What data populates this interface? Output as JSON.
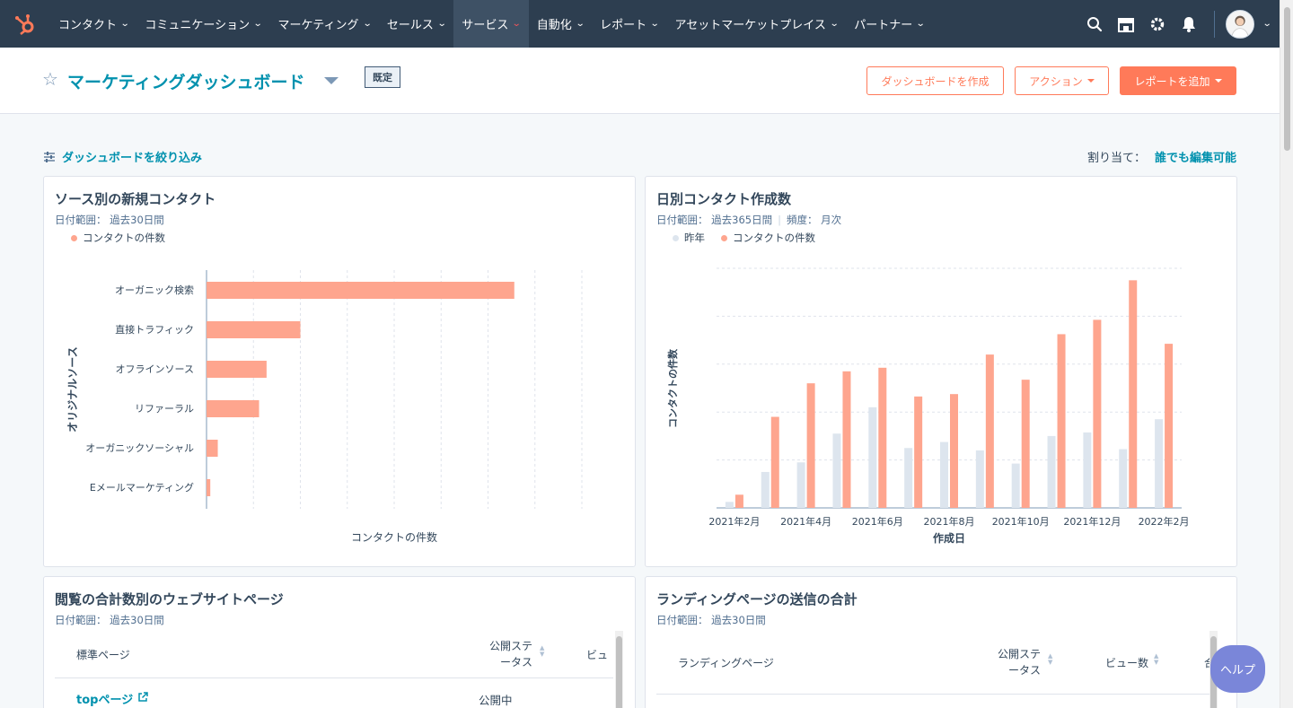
{
  "nav": {
    "items": [
      {
        "label": "コンタクト",
        "active": false
      },
      {
        "label": "コミュニケーション",
        "active": false
      },
      {
        "label": "マーケティング",
        "active": false
      },
      {
        "label": "セールス",
        "active": false
      },
      {
        "label": "サービス",
        "active": true
      },
      {
        "label": "自動化",
        "active": false
      },
      {
        "label": "レポート",
        "active": false
      },
      {
        "label": "アセットマーケットプレイス",
        "active": false
      },
      {
        "label": "パートナー",
        "active": false
      }
    ],
    "chevron": "⌄",
    "icons": [
      "search-icon",
      "marketplace-icon",
      "gear-icon",
      "bell-icon"
    ]
  },
  "header": {
    "title": "マーケティングダッシュボード",
    "badge": "既定",
    "create_button": "ダッシュボードを作成",
    "actions_button": "アクション",
    "add_report_button": "レポートを追加"
  },
  "filters": {
    "filter_label": "ダッシュボードを絞り込み",
    "assign_label": "割り当て：",
    "assign_value": "誰でも編集可能"
  },
  "colors": {
    "accent": "#ff7a59",
    "link": "#0091ae",
    "bar": "#fea58e",
    "prev_year": "#dde5ee"
  },
  "card1": {
    "title": "ソース別の新規コンタクト",
    "subtitle": "日付範囲： 過去30日間",
    "legend": "コンタクトの件数"
  },
  "card2": {
    "title": "日別コンタクト作成数",
    "subtitle": "日付範囲： 過去365日間",
    "subtitle2": "頻度： 月次",
    "legend_prev": "昨年",
    "legend_cur": "コンタクトの件数"
  },
  "card3": {
    "title": "閲覧の合計数別のウェブサイトページ",
    "subtitle": "日付範囲： 過去30日間",
    "col_page": "標準ページ",
    "col_status": "公開ステ\nータス",
    "col_views": "ビュ",
    "rows": [
      {
        "page": "topページ",
        "status": "公開中"
      }
    ]
  },
  "card4": {
    "title": "ランディングページの送信の合計",
    "subtitle": "日付範囲： 過去30日間",
    "col_page": "ランディングページ",
    "col_status": "公開ステ\nータス",
    "col_views": "ビュー数",
    "col_next": "合"
  },
  "help": "ヘルプ",
  "chart_data": [
    {
      "type": "bar",
      "orientation": "horizontal",
      "categories": [
        "オーガニック検索",
        "直接トラフィック",
        "オフラインソース",
        "リファーラル",
        "オーガニックソーシャル",
        "Eメールマーケティング"
      ],
      "values": [
        82,
        25,
        16,
        14,
        3,
        1
      ],
      "xlim": [
        0,
        100
      ],
      "xlabel": "コンタクトの件数",
      "ylabel": "オリジナルソース",
      "grid": true
    },
    {
      "type": "bar",
      "categories": [
        "2021年2月",
        "2021年3月",
        "2021年4月",
        "2021年5月",
        "2021年6月",
        "2021年7月",
        "2021年8月",
        "2021年9月",
        "2021年10月",
        "2021年11月",
        "2021年12月",
        "2022年1月",
        "2022年2月"
      ],
      "tick_labels": [
        "2021年2月",
        "2021年4月",
        "2021年6月",
        "2021年8月",
        "2021年10月",
        "2021年12月",
        "2022年2月"
      ],
      "series": [
        {
          "name": "昨年",
          "values": [
            5,
            30,
            38,
            62,
            84,
            50,
            55,
            48,
            37,
            60,
            63,
            49,
            74
          ]
        },
        {
          "name": "コンタクトの件数",
          "values": [
            11,
            76,
            104,
            114,
            117,
            93,
            95,
            128,
            107,
            145,
            157,
            190,
            137
          ]
        }
      ],
      "xlabel": "作成日",
      "ylabel": "コンタクトの件数",
      "ylim": [
        0,
        200
      ],
      "grid": true
    }
  ]
}
